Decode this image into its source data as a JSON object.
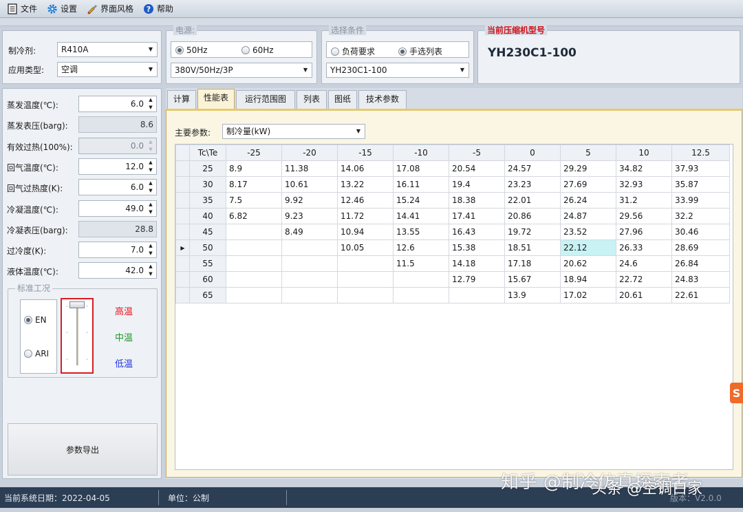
{
  "menu": {
    "file": "文件",
    "settings": "设置",
    "theme": "界面风格",
    "help": "帮助"
  },
  "top_left": {
    "refrigerant_label": "制冷剂:",
    "refrigerant_value": "R410A",
    "app_type_label": "应用类型:",
    "app_type_value": "空调"
  },
  "power": {
    "legend": "电源:",
    "opt_50": "50Hz",
    "opt_60": "60Hz",
    "selected": "50Hz",
    "voltage_value": "380V/50Hz/3P"
  },
  "select_cond": {
    "legend": "选择条件",
    "opt_load": "负荷要求",
    "opt_manual": "手选列表",
    "selected": "手选列表",
    "model_value": "YH230C1-100"
  },
  "current_model": {
    "legend": "当前压缩机型号",
    "value": "YH230C1-100"
  },
  "params": [
    {
      "label": "蒸发温度(℃):",
      "value": "6.0",
      "kind": "spin"
    },
    {
      "label": "蒸发表压(barg):",
      "value": "8.6",
      "kind": "readonly"
    },
    {
      "label": "有效过热(100%):",
      "value": "0.0",
      "kind": "disabled"
    },
    {
      "label": "回气温度(℃):",
      "value": "12.0",
      "kind": "spin"
    },
    {
      "label": "回气过热度(K):",
      "value": "6.0",
      "kind": "spin"
    },
    {
      "label": "冷凝温度(℃):",
      "value": "49.0",
      "kind": "spin"
    },
    {
      "label": "冷凝表压(barg):",
      "value": "28.8",
      "kind": "readonly"
    },
    {
      "label": "过冷度(K):",
      "value": "7.0",
      "kind": "spin"
    },
    {
      "label": "液体温度(℃):",
      "value": "42.0",
      "kind": "spin"
    }
  ],
  "standard": {
    "legend": "标准工况",
    "opt_en": "EN",
    "opt_ari": "ARI",
    "selected": "EN",
    "level_high": "高温",
    "level_mid": "中温",
    "level_low": "低温",
    "slider_level": "高温",
    "colors": {
      "high": "#e8141c",
      "mid": "#1f9a2a",
      "low": "#2233e0"
    }
  },
  "export_button": "参数导出",
  "tabs": [
    {
      "label": "计算",
      "active": false
    },
    {
      "label": "性能表",
      "active": true
    },
    {
      "label": "运行范围图",
      "active": false
    },
    {
      "label": "列表",
      "active": false
    },
    {
      "label": "图纸",
      "active": false
    },
    {
      "label": "技术参数",
      "active": false
    }
  ],
  "main_param": {
    "label": "主要参数:",
    "value": "制冷量(kW)"
  },
  "table": {
    "corner": "Tc\\Te",
    "columns": [
      "-25",
      "-20",
      "-15",
      "-10",
      "-5",
      "0",
      "5",
      "10",
      "12.5"
    ],
    "current_row_index": 5,
    "selected_cell": {
      "row": 5,
      "col": 6
    },
    "rows": [
      {
        "tc": "25",
        "cells": [
          "8.9",
          "11.38",
          "14.06",
          "17.08",
          "20.54",
          "24.57",
          "29.29",
          "34.82",
          "37.93"
        ]
      },
      {
        "tc": "30",
        "cells": [
          "8.17",
          "10.61",
          "13.22",
          "16.11",
          "19.4",
          "23.23",
          "27.69",
          "32.93",
          "35.87"
        ]
      },
      {
        "tc": "35",
        "cells": [
          "7.5",
          "9.92",
          "12.46",
          "15.24",
          "18.38",
          "22.01",
          "26.24",
          "31.2",
          "33.99"
        ]
      },
      {
        "tc": "40",
        "cells": [
          "6.82",
          "9.23",
          "11.72",
          "14.41",
          "17.41",
          "20.86",
          "24.87",
          "29.56",
          "32.2"
        ]
      },
      {
        "tc": "45",
        "cells": [
          "",
          "8.49",
          "10.94",
          "13.55",
          "16.43",
          "19.72",
          "23.52",
          "27.96",
          "30.46"
        ]
      },
      {
        "tc": "50",
        "cells": [
          "",
          "",
          "10.05",
          "12.6",
          "15.38",
          "18.51",
          "22.12",
          "26.33",
          "28.69"
        ]
      },
      {
        "tc": "55",
        "cells": [
          "",
          "",
          "",
          "11.5",
          "14.18",
          "17.18",
          "20.62",
          "24.6",
          "26.84"
        ]
      },
      {
        "tc": "60",
        "cells": [
          "",
          "",
          "",
          "",
          "12.79",
          "15.67",
          "18.94",
          "22.72",
          "24.83"
        ]
      },
      {
        "tc": "65",
        "cells": [
          "",
          "",
          "",
          "",
          "",
          "13.9",
          "17.02",
          "20.61",
          "22.61"
        ]
      }
    ]
  },
  "status": {
    "date": "当前系统日期：2022-04-05",
    "unit": "单位：公制",
    "version": "版本：V2.0.0"
  },
  "watermark": {
    "zhihu": "知乎 @制冷仿真探索者",
    "toutiao": "头条 @空调白家"
  }
}
